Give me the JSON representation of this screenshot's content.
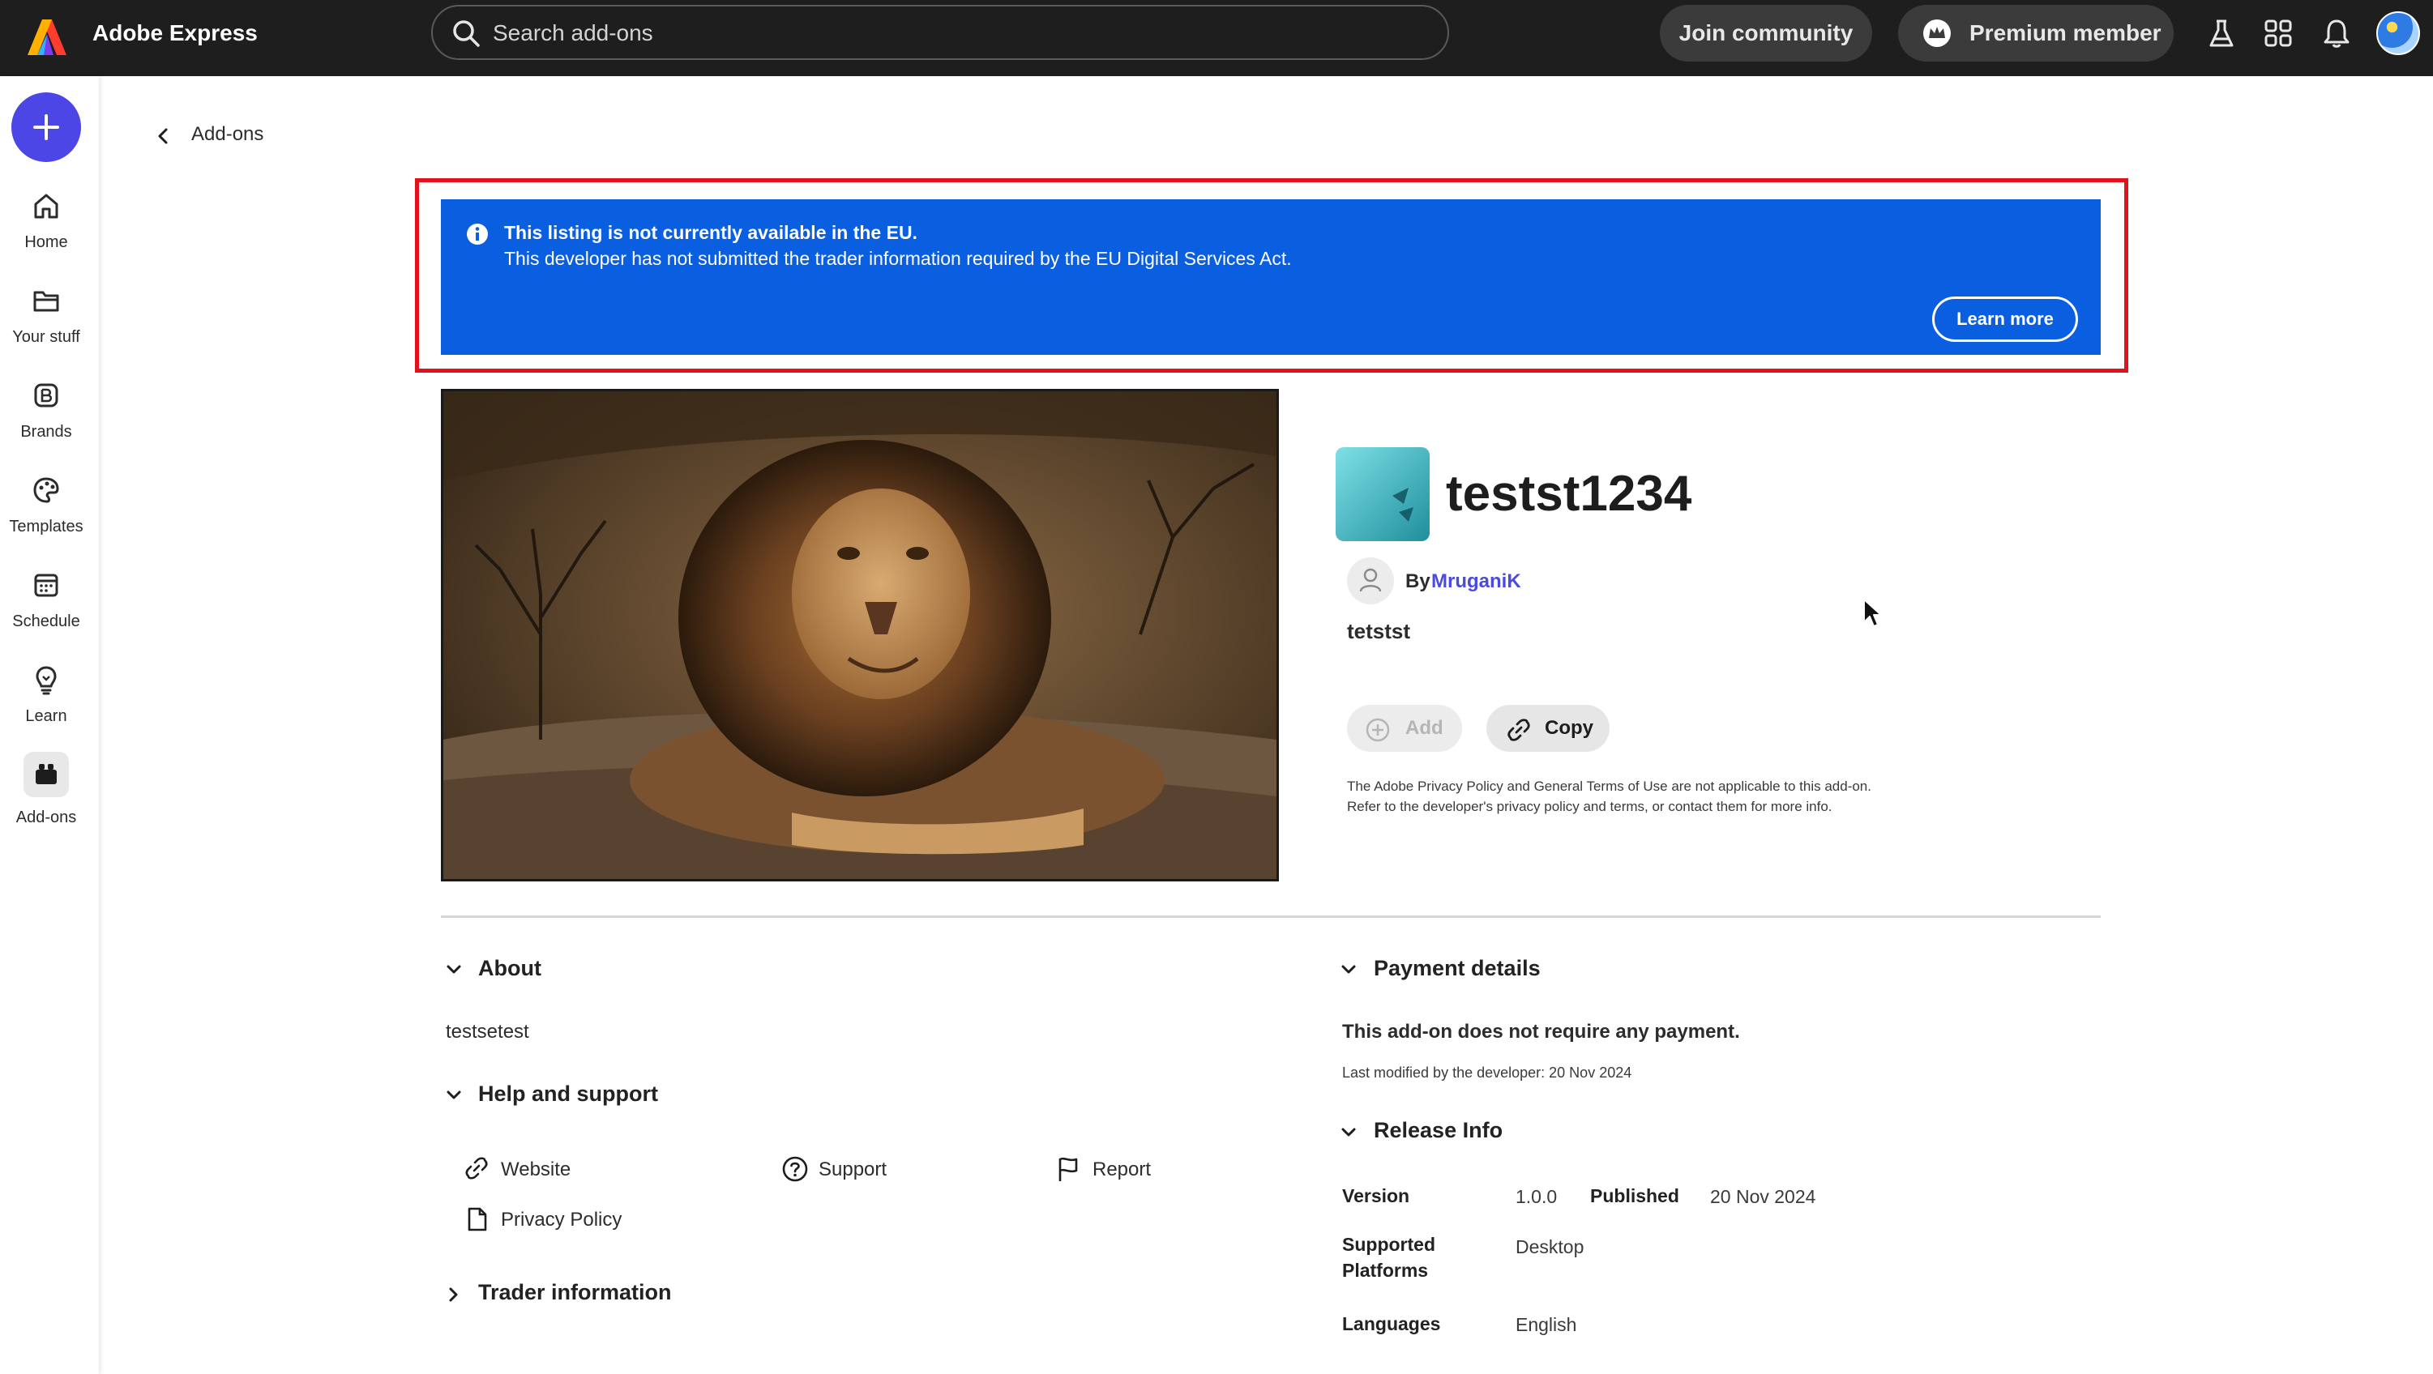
{
  "topbar": {
    "app_title": "Adobe Express",
    "search_placeholder": "Search add-ons",
    "join_label": "Join community",
    "premium_label": "Premium member"
  },
  "rail": {
    "items": [
      {
        "label": "Home",
        "icon": "home-icon"
      },
      {
        "label": "Your stuff",
        "icon": "folder-icon"
      },
      {
        "label": "Brands",
        "icon": "brand-icon"
      },
      {
        "label": "Templates",
        "icon": "templates-icon"
      },
      {
        "label": "Schedule",
        "icon": "calendar-icon"
      },
      {
        "label": "Learn",
        "icon": "lightbulb-icon"
      },
      {
        "label": "Add-ons",
        "icon": "addons-icon",
        "active": true
      }
    ]
  },
  "breadcrumb": {
    "back_label": "Add-ons"
  },
  "banner": {
    "title": "This listing is not currently available in the EU.",
    "text": "This developer has not submitted the trader information required by the EU Digital Services Act.",
    "learn_more": "Learn more",
    "color": "#0a5ee0"
  },
  "addon": {
    "name": "testst1234",
    "by_label": "By",
    "developer": "MruganiK",
    "tagline": "tetstst",
    "add_label": "Add",
    "copy_label": "Copy",
    "policy_line1": "The Adobe Privacy Policy and General Terms of Use are not applicable to this add-on.",
    "policy_line2": "Refer to the developer's privacy policy and terms, or contact them for more info."
  },
  "about": {
    "title": "About",
    "text": "testsetest"
  },
  "help": {
    "title": "Help and support",
    "links": {
      "website": "Website",
      "support": "Support",
      "report": "Report",
      "privacy": "Privacy Policy"
    }
  },
  "trader": {
    "title": "Trader information"
  },
  "payment": {
    "title": "Payment details",
    "text": "This add-on does not require any payment.",
    "modified": "Last modified by the developer: 20 Nov 2024"
  },
  "release": {
    "title": "Release Info",
    "version_label": "Version",
    "version": "1.0.0",
    "published_label": "Published",
    "published": "20 Nov 2024",
    "platforms_label": "Supported Platforms",
    "platforms": "Desktop",
    "languages_label": "Languages",
    "languages": "English"
  }
}
